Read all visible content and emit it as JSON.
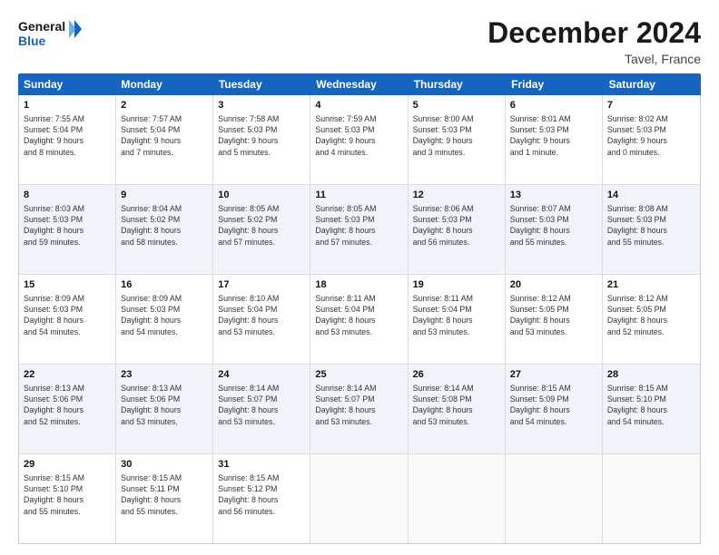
{
  "logo": {
    "line1": "General",
    "line2": "Blue"
  },
  "title": "December 2024",
  "location": "Tavel, France",
  "days_of_week": [
    "Sunday",
    "Monday",
    "Tuesday",
    "Wednesday",
    "Thursday",
    "Friday",
    "Saturday"
  ],
  "weeks": [
    [
      {
        "day": "1",
        "info": "Sunrise: 7:55 AM\nSunset: 5:04 PM\nDaylight: 9 hours\nand 8 minutes."
      },
      {
        "day": "2",
        "info": "Sunrise: 7:57 AM\nSunset: 5:04 PM\nDaylight: 9 hours\nand 7 minutes."
      },
      {
        "day": "3",
        "info": "Sunrise: 7:58 AM\nSunset: 5:03 PM\nDaylight: 9 hours\nand 5 minutes."
      },
      {
        "day": "4",
        "info": "Sunrise: 7:59 AM\nSunset: 5:03 PM\nDaylight: 9 hours\nand 4 minutes."
      },
      {
        "day": "5",
        "info": "Sunrise: 8:00 AM\nSunset: 5:03 PM\nDaylight: 9 hours\nand 3 minutes."
      },
      {
        "day": "6",
        "info": "Sunrise: 8:01 AM\nSunset: 5:03 PM\nDaylight: 9 hours\nand 1 minute."
      },
      {
        "day": "7",
        "info": "Sunrise: 8:02 AM\nSunset: 5:03 PM\nDaylight: 9 hours\nand 0 minutes."
      }
    ],
    [
      {
        "day": "8",
        "info": "Sunrise: 8:03 AM\nSunset: 5:03 PM\nDaylight: 8 hours\nand 59 minutes."
      },
      {
        "day": "9",
        "info": "Sunrise: 8:04 AM\nSunset: 5:02 PM\nDaylight: 8 hours\nand 58 minutes."
      },
      {
        "day": "10",
        "info": "Sunrise: 8:05 AM\nSunset: 5:02 PM\nDaylight: 8 hours\nand 57 minutes."
      },
      {
        "day": "11",
        "info": "Sunrise: 8:05 AM\nSunset: 5:03 PM\nDaylight: 8 hours\nand 57 minutes."
      },
      {
        "day": "12",
        "info": "Sunrise: 8:06 AM\nSunset: 5:03 PM\nDaylight: 8 hours\nand 56 minutes."
      },
      {
        "day": "13",
        "info": "Sunrise: 8:07 AM\nSunset: 5:03 PM\nDaylight: 8 hours\nand 55 minutes."
      },
      {
        "day": "14",
        "info": "Sunrise: 8:08 AM\nSunset: 5:03 PM\nDaylight: 8 hours\nand 55 minutes."
      }
    ],
    [
      {
        "day": "15",
        "info": "Sunrise: 8:09 AM\nSunset: 5:03 PM\nDaylight: 8 hours\nand 54 minutes."
      },
      {
        "day": "16",
        "info": "Sunrise: 8:09 AM\nSunset: 5:03 PM\nDaylight: 8 hours\nand 54 minutes."
      },
      {
        "day": "17",
        "info": "Sunrise: 8:10 AM\nSunset: 5:04 PM\nDaylight: 8 hours\nand 53 minutes."
      },
      {
        "day": "18",
        "info": "Sunrise: 8:11 AM\nSunset: 5:04 PM\nDaylight: 8 hours\nand 53 minutes."
      },
      {
        "day": "19",
        "info": "Sunrise: 8:11 AM\nSunset: 5:04 PM\nDaylight: 8 hours\nand 53 minutes."
      },
      {
        "day": "20",
        "info": "Sunrise: 8:12 AM\nSunset: 5:05 PM\nDaylight: 8 hours\nand 53 minutes."
      },
      {
        "day": "21",
        "info": "Sunrise: 8:12 AM\nSunset: 5:05 PM\nDaylight: 8 hours\nand 52 minutes."
      }
    ],
    [
      {
        "day": "22",
        "info": "Sunrise: 8:13 AM\nSunset: 5:06 PM\nDaylight: 8 hours\nand 52 minutes."
      },
      {
        "day": "23",
        "info": "Sunrise: 8:13 AM\nSunset: 5:06 PM\nDaylight: 8 hours\nand 53 minutes."
      },
      {
        "day": "24",
        "info": "Sunrise: 8:14 AM\nSunset: 5:07 PM\nDaylight: 8 hours\nand 53 minutes."
      },
      {
        "day": "25",
        "info": "Sunrise: 8:14 AM\nSunset: 5:07 PM\nDaylight: 8 hours\nand 53 minutes."
      },
      {
        "day": "26",
        "info": "Sunrise: 8:14 AM\nSunset: 5:08 PM\nDaylight: 8 hours\nand 53 minutes."
      },
      {
        "day": "27",
        "info": "Sunrise: 8:15 AM\nSunset: 5:09 PM\nDaylight: 8 hours\nand 54 minutes."
      },
      {
        "day": "28",
        "info": "Sunrise: 8:15 AM\nSunset: 5:10 PM\nDaylight: 8 hours\nand 54 minutes."
      }
    ],
    [
      {
        "day": "29",
        "info": "Sunrise: 8:15 AM\nSunset: 5:10 PM\nDaylight: 8 hours\nand 55 minutes."
      },
      {
        "day": "30",
        "info": "Sunrise: 8:15 AM\nSunset: 5:11 PM\nDaylight: 8 hours\nand 55 minutes."
      },
      {
        "day": "31",
        "info": "Sunrise: 8:15 AM\nSunset: 5:12 PM\nDaylight: 8 hours\nand 56 minutes."
      },
      {
        "day": "",
        "info": ""
      },
      {
        "day": "",
        "info": ""
      },
      {
        "day": "",
        "info": ""
      },
      {
        "day": "",
        "info": ""
      }
    ]
  ]
}
